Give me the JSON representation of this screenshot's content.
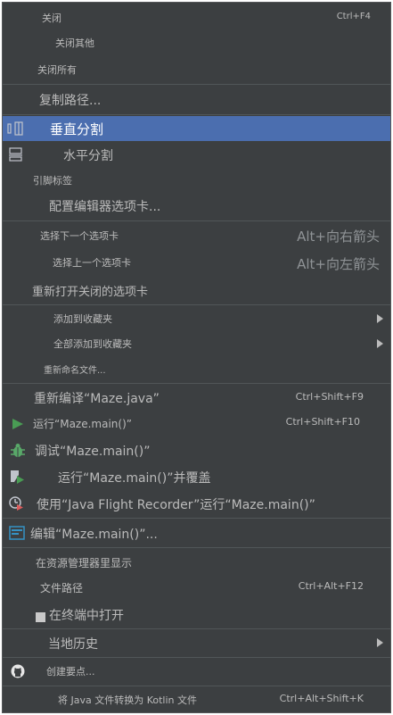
{
  "menu": {
    "close": {
      "label": "关闭",
      "shortcut": "Ctrl+F4"
    },
    "close_others": {
      "label": "关闭其他"
    },
    "close_all": {
      "label": "关闭所有"
    },
    "copy_path": {
      "label": "复制路径..."
    },
    "split_vertical": {
      "label": "垂直分割",
      "icon": "split-vertical-icon"
    },
    "split_horizontal": {
      "label": "水平分割",
      "icon": "split-horizontal-icon"
    },
    "pin_tab": {
      "label": "引脚标签"
    },
    "config_tabs": {
      "label": "配置编辑器选项卡..."
    },
    "next_tab": {
      "label": "选择下一个选项卡",
      "shortcut": "Alt+向右箭头"
    },
    "prev_tab": {
      "label": "选择上一个选项卡",
      "shortcut": "Alt+向左箭头"
    },
    "reopen_closed": {
      "label": "重新打开关闭的选项卡"
    },
    "add_favorites": {
      "label": "添加到收藏夹"
    },
    "add_all_favorites": {
      "label": "全部添加到收藏夹"
    },
    "rename_file": {
      "label": "重新命名文件..."
    },
    "recompile": {
      "label": "重新编译“Maze.java”",
      "shortcut": "Ctrl+Shift+F9"
    },
    "run": {
      "label": "运行“Maze.main()”",
      "shortcut": "Ctrl+Shift+F10",
      "icon": "run-icon"
    },
    "debug": {
      "label": "调试“Maze.main()”",
      "icon": "debug-icon"
    },
    "run_coverage": {
      "label": "运行“Maze.main()”并覆盖",
      "icon": "coverage-icon"
    },
    "flight_recorder": {
      "label": "使用“Java Flight Recorder”运行“Maze.main()”",
      "icon": "profiler-icon"
    },
    "edit_config": {
      "label": "编辑“Maze.main()”...",
      "icon": "edit-config-icon"
    },
    "show_explorer": {
      "label": "在资源管理器里显示"
    },
    "file_path": {
      "label": "文件路径",
      "shortcut": "Ctrl+Alt+F12"
    },
    "open_terminal": {
      "label": "在终端中打开",
      "icon": "terminal-icon"
    },
    "local_history": {
      "label": "当地历史"
    },
    "create_gist": {
      "label": "创建要点...",
      "icon": "github-icon"
    },
    "convert_kotlin": {
      "label": "将 Java 文件转换为 Kotlin 文件",
      "shortcut": "Ctrl+Alt+Shift+K"
    }
  },
  "colors": {
    "background": "#3c3f41",
    "selection": "#4b6eaf",
    "text": "#bbbbbb",
    "separator": "#515658",
    "run_green": "#499c54",
    "debug_green": "#59a869"
  }
}
